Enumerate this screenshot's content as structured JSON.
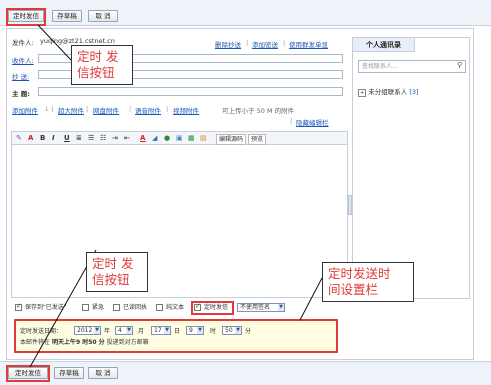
{
  "toolbar": {
    "send_scheduled": "定时发信",
    "save_draft": "存草稿",
    "cancel": "取 消"
  },
  "header": {
    "sender_label": "发件人:",
    "sender_value": "yuqing@zt21.cstnet.cn",
    "to_label": "收件人:",
    "cc_label": "抄 送:",
    "subject_label": "主 题:",
    "delete_cc": "删除抄送",
    "add_bcc": "添加密送",
    "use_group": "使用群发单显"
  },
  "attachments": {
    "add": "添加附件",
    "big": "超大附件",
    "disk": "网盘附件",
    "voice": "语音附件",
    "video": "视频附件",
    "hint": "可上传小于 50 M 的附件",
    "hide_editor": "隐藏编辑栏"
  },
  "editor_toolbar": {
    "bold": "B",
    "italic": "I",
    "underline": "U",
    "source": "编辑源码",
    "preview": "预览"
  },
  "contacts": {
    "tab": "个人通讯录",
    "search_placeholder": "查找联系人...",
    "group": "未分组联系人",
    "group_count": "[3]"
  },
  "options": {
    "save_sent": "保存到\"已发送\"",
    "urgent": "紧急",
    "read_receipt": "已读回执",
    "plain_text": "纯文本",
    "scheduled": "定时发信",
    "signature": "不使用签名"
  },
  "schedule": {
    "label": "定时发送日期：",
    "year": "2012",
    "year_unit": "年",
    "month": "4",
    "month_unit": "月",
    "day": "17",
    "day_unit": "日",
    "hour": "9",
    "hour_unit": "时",
    "minute": "50",
    "minute_unit": "分",
    "note_prefix": "本邮件将在",
    "note_time": "明天上午9 时50 分",
    "note_suffix": "投递到对方邮箱"
  },
  "callouts": {
    "top": "定时 发\n信按钮",
    "bottom": "定时 发\n信按钮",
    "right": "定时发送时\n间设置栏"
  }
}
